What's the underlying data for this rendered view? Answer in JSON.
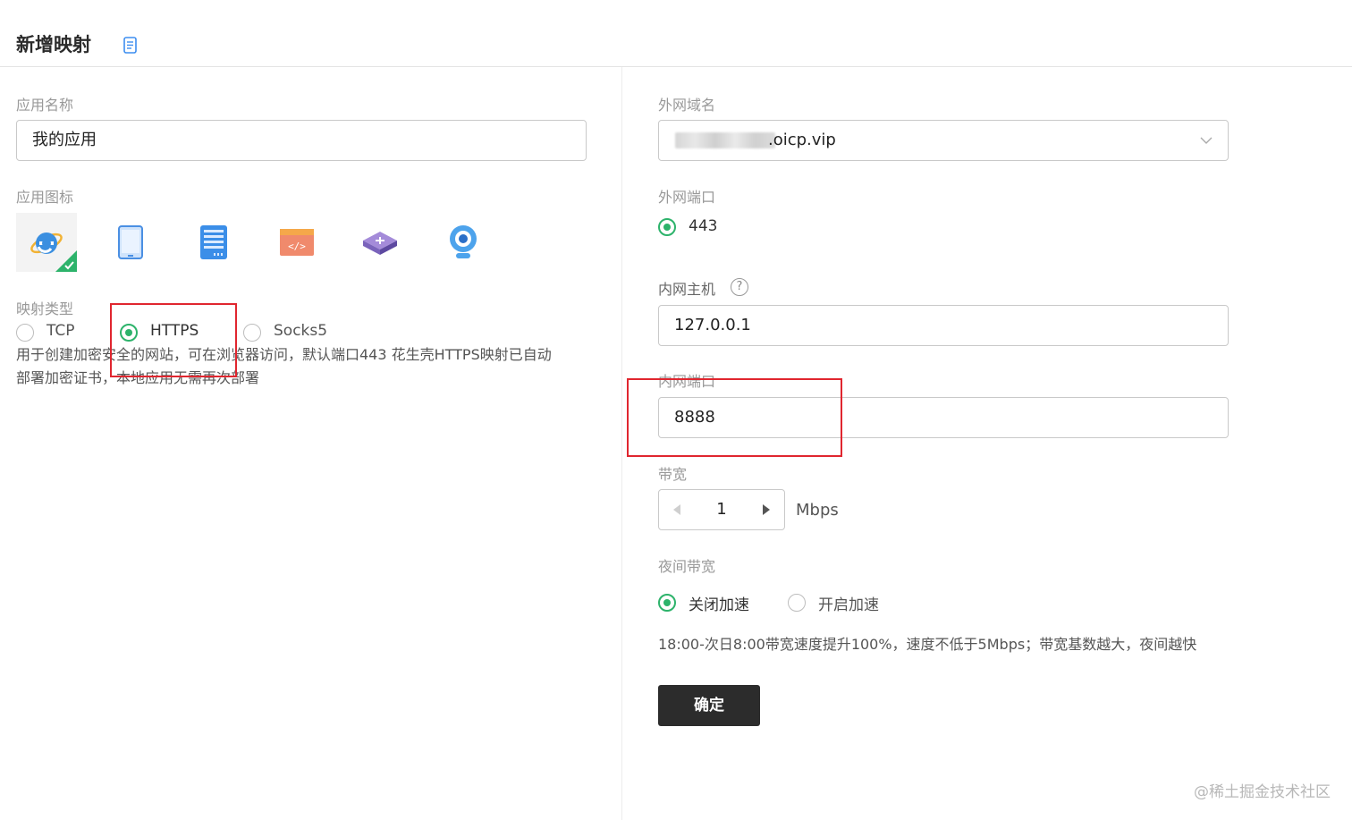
{
  "header": {
    "title": "新增映射",
    "doc_icon": "document-icon"
  },
  "left": {
    "app_name": {
      "label": "应用名称",
      "value": "我的应用"
    },
    "app_icon": {
      "label": "应用图标",
      "icons": [
        "ie-browser-icon",
        "tablet-icon",
        "server-icon",
        "code-window-icon",
        "router-icon",
        "webcam-icon"
      ],
      "selected": "ie-browser-icon"
    },
    "mapping_type": {
      "label": "映射类型",
      "options": [
        "TCP",
        "HTTPS",
        "Socks5"
      ],
      "selected": "HTTPS",
      "description_line1": "用于创建加密安全的网站，可在浏览器访问，默认端口443 花生壳HTTPS映射已自动",
      "description_line2": "部署加密证书，本地应用无需再次部署"
    }
  },
  "right": {
    "external_domain": {
      "label": "外网域名",
      "value": ".oicp.vip"
    },
    "external_port": {
      "label": "外网端口",
      "value": "443"
    },
    "internal_host": {
      "label": "内网主机",
      "value": "127.0.0.1",
      "help": "?"
    },
    "internal_port": {
      "label": "内网端口",
      "value": "8888"
    },
    "bandwidth": {
      "label": "带宽",
      "value": "1",
      "unit": "Mbps"
    },
    "night_bandwidth": {
      "label": "夜间带宽",
      "options": [
        "关闭加速",
        "开启加速"
      ],
      "selected": "关闭加速",
      "hint": "18:00-次日8:00带宽速度提升100%，速度不低于5Mbps；带宽基数越大，夜间越快"
    },
    "confirm_label": "确定"
  },
  "watermark": "@稀土掘金技术社区",
  "colors": {
    "accent_green": "#2db36b",
    "highlight_red": "#e0262f",
    "button_dark": "#2c2c2c"
  }
}
